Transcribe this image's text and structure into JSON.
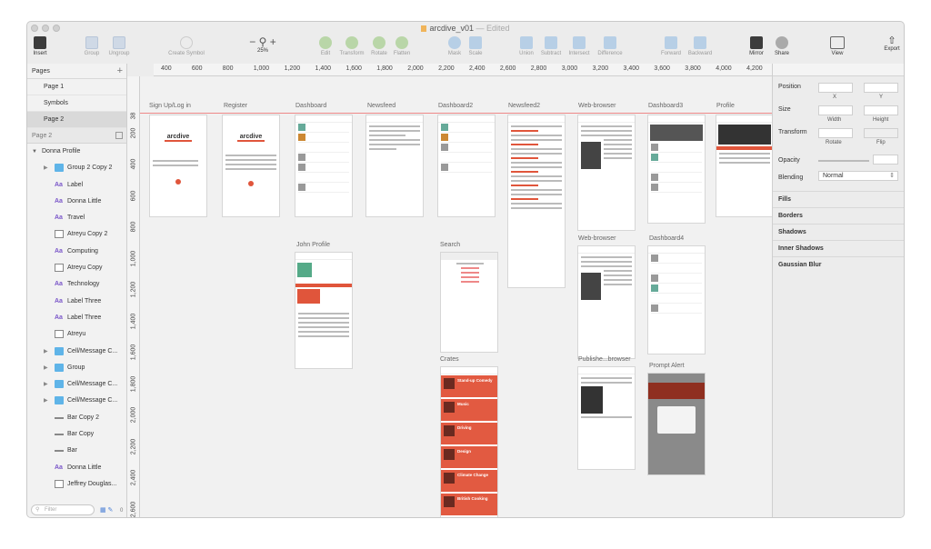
{
  "window": {
    "title": "arcdive_v01",
    "status": "— Edited"
  },
  "toolbar": {
    "insert": "Insert",
    "group": "Group",
    "ungroup": "Ungroup",
    "create_symbol": "Create Symbol",
    "zoom": "25%",
    "edit": "Edit",
    "transform": "Transform",
    "rotate": "Rotate",
    "flatten": "Flatten",
    "mask": "Mask",
    "scale": "Scale",
    "union": "Union",
    "subtract": "Subtract",
    "intersect": "Intersect",
    "difference": "Difference",
    "forward": "Forward",
    "backward": "Backward",
    "mirror": "Mirror",
    "share": "Share",
    "view": "View",
    "export": "Export"
  },
  "ruler": {
    "h": [
      "400",
      "600",
      "800",
      "1,000",
      "1,200",
      "1,400",
      "1,600",
      "1,800",
      "2,000",
      "2,200",
      "2,400",
      "2,600",
      "2,800",
      "3,000",
      "3,200",
      "3,400",
      "3,600",
      "3,800",
      "4,000",
      "4,200"
    ],
    "v": [
      "38",
      "200",
      "400",
      "600",
      "800",
      "1,000",
      "1,200",
      "1,400",
      "1,600",
      "1,800",
      "2,000",
      "2,200",
      "2,400",
      "2,600"
    ]
  },
  "sidebar": {
    "pages_title": "Pages",
    "pages": [
      "Page 1",
      "Symbols",
      "Page 2"
    ],
    "current_page": "Page 2",
    "artboard": "Donna Profile",
    "layers": [
      {
        "label": "Group 2 Copy 2",
        "type": "folder"
      },
      {
        "label": "Label",
        "type": "text"
      },
      {
        "label": "Donna Little",
        "type": "text"
      },
      {
        "label": "Travel",
        "type": "text"
      },
      {
        "label": "Atreyu  Copy 2",
        "type": "rect"
      },
      {
        "label": "Computing",
        "type": "text"
      },
      {
        "label": "Atreyu  Copy",
        "type": "rect"
      },
      {
        "label": "Technology",
        "type": "text"
      },
      {
        "label": "Label Three",
        "type": "text"
      },
      {
        "label": "Label Three",
        "type": "text"
      },
      {
        "label": "Atreyu",
        "type": "rect"
      },
      {
        "label": "Cell/Message C...",
        "type": "folder"
      },
      {
        "label": "Group",
        "type": "folder"
      },
      {
        "label": "Cell/Message C...",
        "type": "folder"
      },
      {
        "label": "Cell/Message C...",
        "type": "folder"
      },
      {
        "label": "Bar Copy 2",
        "type": "line"
      },
      {
        "label": "Bar Copy",
        "type": "line"
      },
      {
        "label": "Bar",
        "type": "line"
      },
      {
        "label": "Donna Little",
        "type": "text"
      },
      {
        "label": "Jeffrey Douglas...",
        "type": "rect"
      }
    ],
    "filter_placeholder": "Filter",
    "filter_count": "0"
  },
  "artboards": {
    "signup": "Sign Up/Log in",
    "register": "Register",
    "dashboard": "Dashboard",
    "newsfeed": "Newsfeed",
    "dashboard2": "Dashboard2",
    "newsfeed2": "Newsfeed2",
    "webbrowser": "Web-browser",
    "dashboard3": "Dashboard3",
    "profile": "Profile",
    "john": "John Profile",
    "search": "Search",
    "webbrowser2": "Web-browser",
    "dashboard4": "Dashboard4",
    "crates": "Crates",
    "publisher": "Publishe...browser",
    "prompt": "Prompt Alert",
    "logo": "arcdive",
    "crate_items": [
      "Stand-up Comedy",
      "Music",
      "Driving",
      "Design",
      "Climate Change",
      "British Cooking"
    ]
  },
  "inspector": {
    "position": "Position",
    "x": "X",
    "y": "Y",
    "size": "Size",
    "width": "Width",
    "height": "Height",
    "transform": "Transform",
    "rotate": "Rotate",
    "flip": "Flip",
    "opacity": "Opacity",
    "blending": "Blending",
    "blend_mode": "Normal",
    "sections": [
      "Fills",
      "Borders",
      "Shadows",
      "Inner Shadows",
      "Gaussian Blur"
    ]
  },
  "colors": {
    "accent": "#e0553b",
    "folder": "#5fb4e8"
  }
}
